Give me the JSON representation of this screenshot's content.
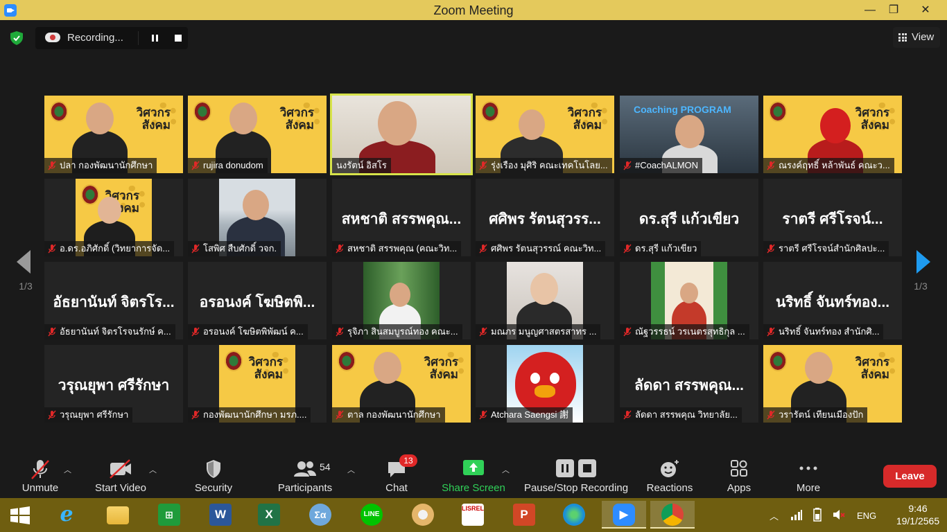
{
  "window": {
    "title": "Zoom Meeting",
    "minimize": "—",
    "maximize": "❐",
    "close": "✕"
  },
  "recording": {
    "label": "Recording..."
  },
  "view": {
    "label": "View"
  },
  "pagination": {
    "left_page": "1/3",
    "right_page": "1/3"
  },
  "tiles": [
    {
      "name": "ปลา กองพัฒนานักศึกษา",
      "muted": true,
      "video": "poster-woman"
    },
    {
      "name": "rujira donudom",
      "muted": true,
      "video": "poster-woman"
    },
    {
      "name": "นงรัตน์ อิสโร",
      "muted": false,
      "active": true,
      "video": "room-woman"
    },
    {
      "name": "รุ่งเรือง มุศิริ คณะเทคโนโลย...",
      "muted": true,
      "video": "poster-man"
    },
    {
      "name": "#CoachALMON",
      "muted": true,
      "video": "coach",
      "overlay": "Coaching PROGRAM"
    },
    {
      "name": "ณรงค์ฤทธิ์ หล้าพันธ์ คณะว...",
      "muted": true,
      "video": "poster-spider"
    },
    {
      "name": "อ.ดร.อภิศักดิ์ (วิทยาการจัด...",
      "muted": true,
      "video": "poster-man2"
    },
    {
      "name": "โสพิศ สืบศักดิ์ วจก.",
      "muted": true,
      "video": "sea-woman"
    },
    {
      "name": "สหชาติ สรรพคุณ (คณะวิท...",
      "muted": true,
      "big": "สหชาติ สรรพคุณ..."
    },
    {
      "name": "ศศิพร รัตนสุวรรณ์ คณะวิท...",
      "muted": true,
      "big": "ศศิพร รัตนสุวรร..."
    },
    {
      "name": "ดร.สุรี  แก้วเขียว",
      "muted": true,
      "big": "ดร.สุรี  แก้วเขียว"
    },
    {
      "name": "ราตรี   ศรีโรจน์สำนักศิลปะ...",
      "muted": true,
      "big": "ราตรี   ศรีโรจน์..."
    },
    {
      "name": "อัธยานันท์ จิตรโรจนรักษ์ ค...",
      "muted": true,
      "big": "อัธยานันท์ จิตรโร..."
    },
    {
      "name": "อรอนงค์ โฆษิตพิพัฒน์ ค...",
      "muted": true,
      "big": "อรอนงค์ โฆษิตพิ..."
    },
    {
      "name": "รุจิภา สินสมบูรณ์ทอง คณะ...",
      "muted": true,
      "video": "green-woman"
    },
    {
      "name": "มณภร มนูญศาสตรสาทร ...",
      "muted": true,
      "video": "office-woman"
    },
    {
      "name": "ณัฐวรรธน์ วรเนตรสุทธิกุล ...",
      "muted": true,
      "video": "stage"
    },
    {
      "name": "นริทธิ์ จันทร์ทอง สำนักศิ...",
      "muted": true,
      "big": "นริทธิ์ จันทร์ทอง..."
    },
    {
      "name": "วรุณยุพา ศรีรักษา",
      "muted": true,
      "big": "วรุณยุพา ศรีรักษา"
    },
    {
      "name": "กองพัฒนานักศึกษา มรภ....",
      "muted": true,
      "video": "poster-seal"
    },
    {
      "name": "ตาล กองพัฒนานักศึกษา",
      "muted": true,
      "video": "poster-woman"
    },
    {
      "name": "Atchara Saengsi 謝",
      "muted": true,
      "video": "bird"
    },
    {
      "name": "ลัดดา สรรพคุณ  วิทยาลัย...",
      "muted": true,
      "big": "ลัดดา สรรพคุณ..."
    },
    {
      "name": "วรารัตน์ เทียนเมืองปัก",
      "muted": true,
      "video": "poster-woman"
    }
  ],
  "poster_text": "วิศวกรสังคม",
  "toolbar": {
    "unmute": "Unmute",
    "start_video": "Start Video",
    "security": "Security",
    "participants": "Participants",
    "participants_count": "54",
    "chat": "Chat",
    "chat_badge": "13",
    "share_screen": "Share Screen",
    "recording": "Pause/Stop Recording",
    "reactions": "Reactions",
    "apps": "Apps",
    "more": "More",
    "leave": "Leave"
  },
  "taskbar": {
    "apps": [
      "start",
      "internet-explorer",
      "file-explorer",
      "store",
      "word",
      "excel",
      "math-input",
      "line",
      "paint",
      "lisrel",
      "powerpoint",
      "edge",
      "zoom",
      "chrome"
    ],
    "lang": "ENG",
    "time": "9:46",
    "date": "19/1/2565"
  },
  "colors": {
    "title_bar": "#e4c95c",
    "taskbar": "#6f5e10",
    "leave": "#d72a2a",
    "active_speaker": "#d7e34a",
    "share_green": "#30d158"
  }
}
